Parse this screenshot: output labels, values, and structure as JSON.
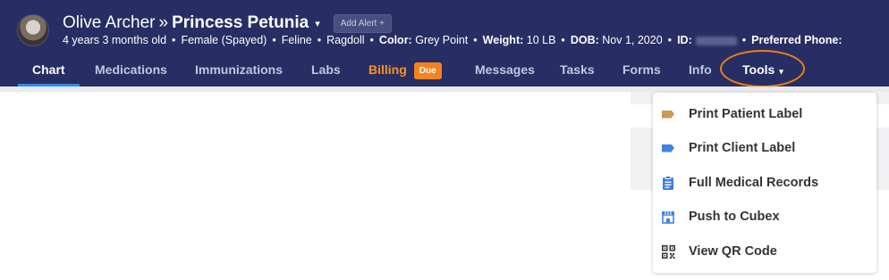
{
  "header": {
    "owner_name": "Olive Archer",
    "separator": "»",
    "pet_name": "Princess Petunia",
    "pet_caret": "▾",
    "add_alert_label": "Add Alert +",
    "info": {
      "age": "4 years 3 months old",
      "sex": "Female (Spayed)",
      "species": "Feline",
      "breed": "Ragdoll",
      "color_label": "Color:",
      "color_value": "Grey Point",
      "weight_label": "Weight:",
      "weight_value": "10 LB",
      "dob_label": "DOB:",
      "dob_value": "Nov 1, 2020",
      "id_label": "ID:",
      "preferred_phone_label": "Preferred Phone:",
      "bullet": "•"
    }
  },
  "tabs": {
    "chart": "Chart",
    "medications": "Medications",
    "immunizations": "Immunizations",
    "labs": "Labs",
    "billing": "Billing",
    "billing_badge": "Due",
    "messages": "Messages",
    "tasks": "Tasks",
    "forms": "Forms",
    "info": "Info",
    "tools": "Tools",
    "tools_caret": "▾"
  },
  "tools_menu": [
    {
      "label": "Print Patient Label",
      "icon": "tag-icon",
      "color": "#c99a55"
    },
    {
      "label": "Print Client Label",
      "icon": "tag-icon",
      "color": "#3f82e6"
    },
    {
      "label": "Full Medical Records",
      "icon": "clipboard-icon",
      "color": "#3f7ee0"
    },
    {
      "label": "Push to Cubex",
      "icon": "store-icon",
      "color": "#3f82e6"
    },
    {
      "label": "View QR Code",
      "icon": "qr-code-icon",
      "color": "#333333"
    }
  ],
  "colors": {
    "header_bg": "#272e63",
    "active_underline": "#2d8cf0",
    "billing_accent": "#f5821f",
    "highlight_ring": "#f07f12"
  }
}
